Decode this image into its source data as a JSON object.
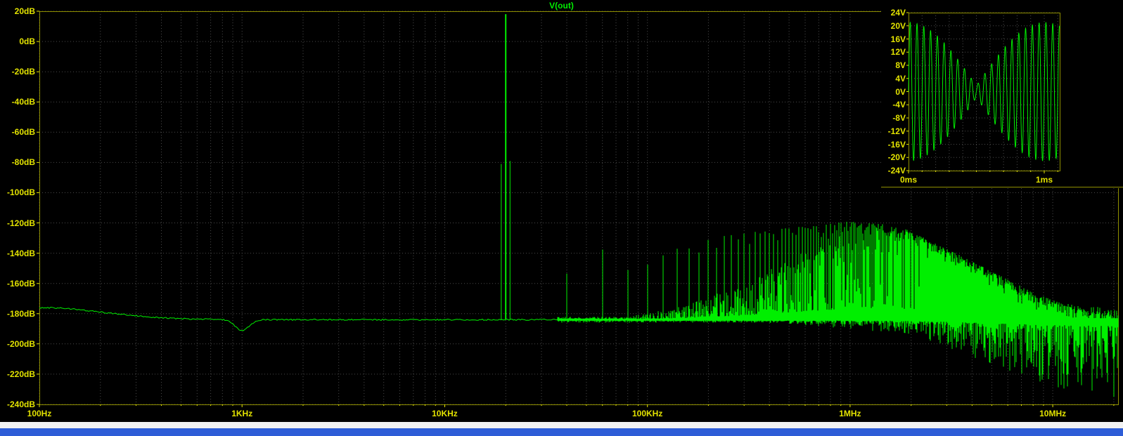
{
  "ui": {
    "plot_bg": "#000000",
    "grid_color": "#4a4a4a",
    "frame_color": "#8f8f00",
    "statusbar_color": "#f2f2f2",
    "background_window_color": "#2e5dd7"
  },
  "chart_data": [
    {
      "id": "fft-spectrum",
      "type": "line",
      "title": "V(out)",
      "x_scale": "log",
      "x_unit": "Hz",
      "x_range": [
        100,
        21000000
      ],
      "x_tick_values": [
        100,
        1000,
        10000,
        100000,
        1000000,
        10000000
      ],
      "x_tick_labels": [
        "100Hz",
        "1KHz",
        "10KHz",
        "100KHz",
        "1MHz",
        "10MHz"
      ],
      "y_unit": "dB",
      "y_range": [
        -240,
        20
      ],
      "y_tick_step": 20,
      "y_tick_labels": [
        "20dB",
        "0dB",
        "-20dB",
        "-40dB",
        "-60dB",
        "-80dB",
        "-100dB",
        "-120dB",
        "-140dB",
        "-160dB",
        "-180dB",
        "-200dB",
        "-220dB",
        "-240dB"
      ],
      "trace_color": "#00ef00",
      "label_color": "#e2e200",
      "grid": true,
      "noise_floor": {
        "at_100hz": -176,
        "flat": -184,
        "dip": {
          "freq": 1000,
          "depth": 7
        }
      },
      "main_spike": {
        "freq": 20000,
        "peak_db": 18,
        "sidebands": [
          {
            "freq": 19000,
            "peak_db": -81
          },
          {
            "freq": 21000,
            "peak_db": -79
          }
        ]
      },
      "harmonic_comb": {
        "spacing_hz": 20000,
        "envelope": [
          [
            40000,
            -152
          ],
          [
            60000,
            -136
          ],
          [
            80000,
            -151
          ],
          [
            100000,
            -146
          ],
          [
            150000,
            -135
          ],
          [
            250000,
            -128
          ],
          [
            500000,
            -123
          ],
          [
            1000000,
            -119
          ],
          [
            1500000,
            -121
          ],
          [
            2000000,
            -126
          ],
          [
            3000000,
            -137
          ],
          [
            5000000,
            -152
          ],
          [
            8000000,
            -166
          ],
          [
            12000000,
            -175
          ],
          [
            21000000,
            -183
          ]
        ]
      },
      "noise_band": {
        "envelope_top": [
          [
            80000,
            -182
          ],
          [
            150000,
            -175
          ],
          [
            300000,
            -160
          ],
          [
            600000,
            -138
          ],
          [
            1000000,
            -124
          ],
          [
            2000000,
            -124
          ],
          [
            3000000,
            -140
          ],
          [
            5000000,
            -158
          ],
          [
            8000000,
            -168
          ],
          [
            12000000,
            -173
          ],
          [
            21000000,
            -177
          ]
        ],
        "envelope_bottom": [
          [
            400000,
            -186
          ],
          [
            1000000,
            -190
          ],
          [
            2000000,
            -194
          ],
          [
            3000000,
            -202
          ],
          [
            5000000,
            -214
          ],
          [
            8000000,
            -224
          ],
          [
            12000000,
            -231
          ],
          [
            21000000,
            -237
          ]
        ]
      }
    },
    {
      "id": "time-domain-inset",
      "type": "line",
      "x_unit": "ms",
      "x_range": [
        0,
        1.114
      ],
      "x_tick_values": [
        0,
        1
      ],
      "x_tick_labels": [
        "0ms",
        "1ms"
      ],
      "y_unit": "V",
      "y_range": [
        -24,
        24
      ],
      "y_tick_step": 4,
      "y_tick_labels": [
        "24V",
        "20V",
        "16V",
        "12V",
        "8V",
        "4V",
        "0V",
        "-4V",
        "-8V",
        "-12V",
        "-16V",
        "-20V",
        "-24V"
      ],
      "trace_color": "#00ef00",
      "label_color": "#e2e200",
      "grid": true,
      "signal": {
        "kind": "am-modulated-sine",
        "carrier_khz": 20,
        "envelope_max_v": 21,
        "envelope_min_v": 1.8,
        "envelope_period_ms": 2,
        "waist_at_ms": 0.5
      }
    }
  ]
}
